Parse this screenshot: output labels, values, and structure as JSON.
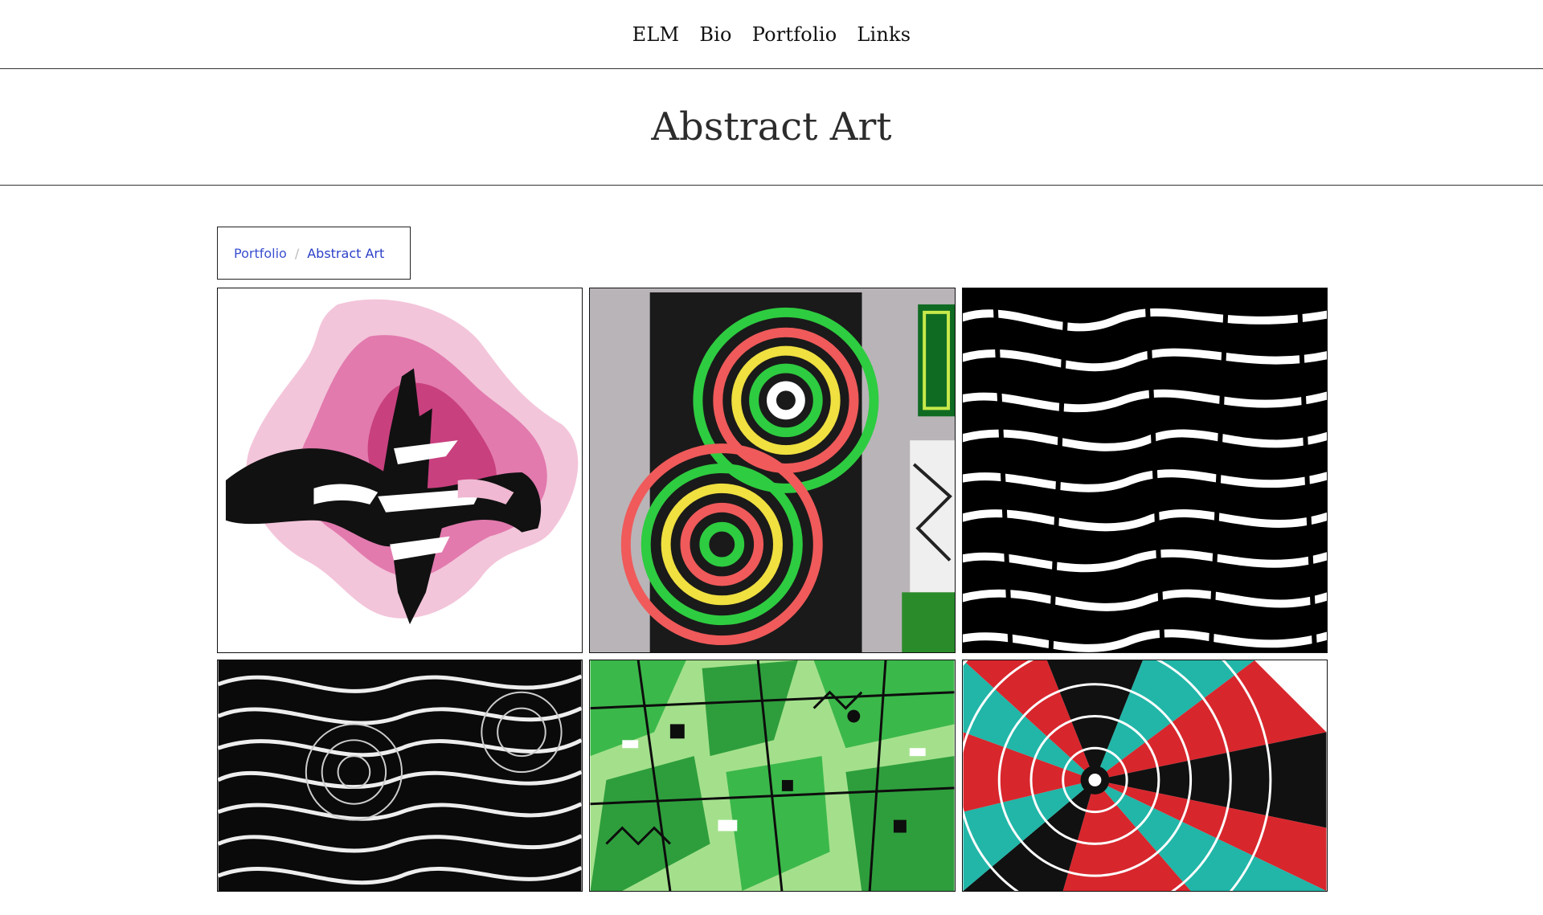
{
  "nav": {
    "items": [
      "ELM",
      "Bio",
      "Portfolio",
      "Links"
    ]
  },
  "header": {
    "title": "Abstract Art"
  },
  "breadcrumb": {
    "parent": "Portfolio",
    "separator": "/",
    "current": "Abstract Art"
  },
  "gallery": {
    "artworks": [
      {
        "name": "pink-black-abstract",
        "palette": [
          "#ffffff",
          "#d9609a",
          "#f0b8d2",
          "#111111"
        ]
      },
      {
        "name": "green-swirl-canvas",
        "palette": [
          "#1a1a1a",
          "#2ecc40",
          "#f0e040",
          "#f05a5a"
        ]
      },
      {
        "name": "black-white-zebra",
        "palette": [
          "#000000",
          "#ffffff"
        ]
      },
      {
        "name": "black-white-waves",
        "palette": [
          "#0a0a0a",
          "#eeeeee"
        ]
      },
      {
        "name": "green-geometric",
        "palette": [
          "#3bb84a",
          "#a4e08c",
          "#0d0d0d",
          "#ffffff"
        ]
      },
      {
        "name": "red-teal-radial",
        "palette": [
          "#d8262d",
          "#21b6a8",
          "#111111",
          "#ffffff"
        ]
      }
    ]
  }
}
